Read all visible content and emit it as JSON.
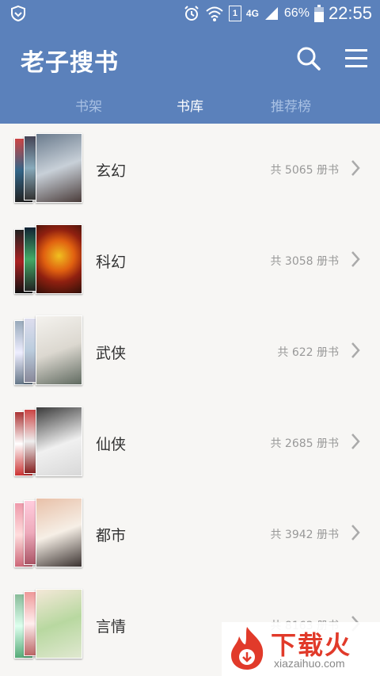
{
  "status": {
    "battery": "66%",
    "time": "22:55",
    "network": "4G",
    "sim": "1"
  },
  "header": {
    "title": "老子搜书",
    "search_icon": "search-icon",
    "menu_icon": "menu-icon"
  },
  "tabs": [
    {
      "label": "书架"
    },
    {
      "label": "书库"
    },
    {
      "label": "推荐榜"
    }
  ],
  "active_tab": "书库",
  "categories": [
    {
      "name": "玄幻",
      "count": "共 5065 册书"
    },
    {
      "name": "科幻",
      "count": "共 3058 册书"
    },
    {
      "name": "武侠",
      "count": "共 622 册书"
    },
    {
      "name": "仙侠",
      "count": "共 2685 册书"
    },
    {
      "name": "都市",
      "count": "共 3942 册书"
    },
    {
      "name": "言情",
      "count": "共 8163 册书"
    }
  ],
  "watermark": {
    "text": "下载火",
    "url": "xiazaihuo.com"
  },
  "colors": {
    "primary": "#5b81bb",
    "tab_inactive": "#a8c0e3",
    "watermark": "#e13a2a"
  }
}
